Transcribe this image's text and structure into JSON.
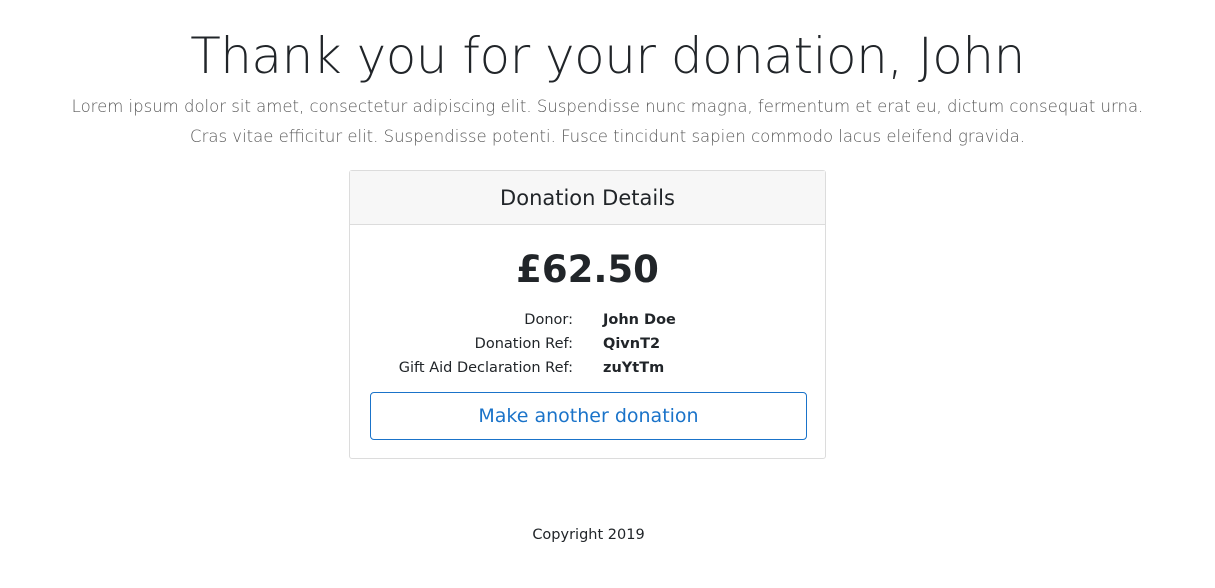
{
  "hero": {
    "title": "Thank you for your donation, John",
    "lead_line1": "Lorem ipsum dolor sit amet, consectetur adipiscing elit. Suspendisse nunc magna, fermentum et erat eu, dictum consequat urna.",
    "lead_line2": "Cras vitae efficitur elit. Suspendisse potenti. Fusce tincidunt sapien commodo lacus eleifend gravida."
  },
  "card": {
    "header": "Donation Details",
    "amount": "£62.50",
    "details": [
      {
        "label": "Donor:",
        "value": "John Doe"
      },
      {
        "label": "Donation Ref:",
        "value": "QivnT2"
      },
      {
        "label": "Gift Aid Declaration Ref:",
        "value": "zuYtTm"
      }
    ],
    "button_label": "Make another donation"
  },
  "footer": {
    "copyright": "Copyright 2019"
  },
  "colors": {
    "accent": "#1a73c9",
    "header_bg": "#f7f7f7",
    "border": "#dcdcdc"
  }
}
